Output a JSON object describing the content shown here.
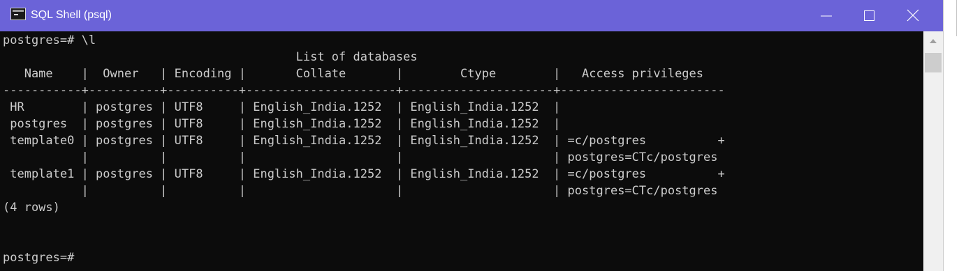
{
  "window": {
    "title": "SQL Shell (psql)",
    "app_icon": "console-icon",
    "controls": {
      "minimize": "minimize-icon",
      "maximize": "maximize-icon",
      "close": "close-icon"
    }
  },
  "colors": {
    "titlebar": "#6b63d8",
    "terminal_bg": "#0c0c0c",
    "terminal_fg": "#cccccc"
  },
  "terminal": {
    "lines": [
      "postgres=# \\l",
      "                                         List of databases",
      "   Name    |  Owner   | Encoding |       Collate       |        Ctype        |   Access privileges",
      "-----------+----------+----------+---------------------+---------------------+-----------------------",
      " HR        | postgres | UTF8     | English_India.1252  | English_India.1252  |",
      " postgres  | postgres | UTF8     | English_India.1252  | English_India.1252  |",
      " template0 | postgres | UTF8     | English_India.1252  | English_India.1252  | =c/postgres          +",
      "           |          |          |                     |                     | postgres=CTc/postgres",
      " template1 | postgres | UTF8     | English_India.1252  | English_India.1252  | =c/postgres          +",
      "           |          |          |                     |                     | postgres=CTc/postgres",
      "(4 rows)",
      "",
      "",
      "postgres=#"
    ]
  },
  "scrollbar": {
    "up_arrow": "chevron-up-icon"
  }
}
